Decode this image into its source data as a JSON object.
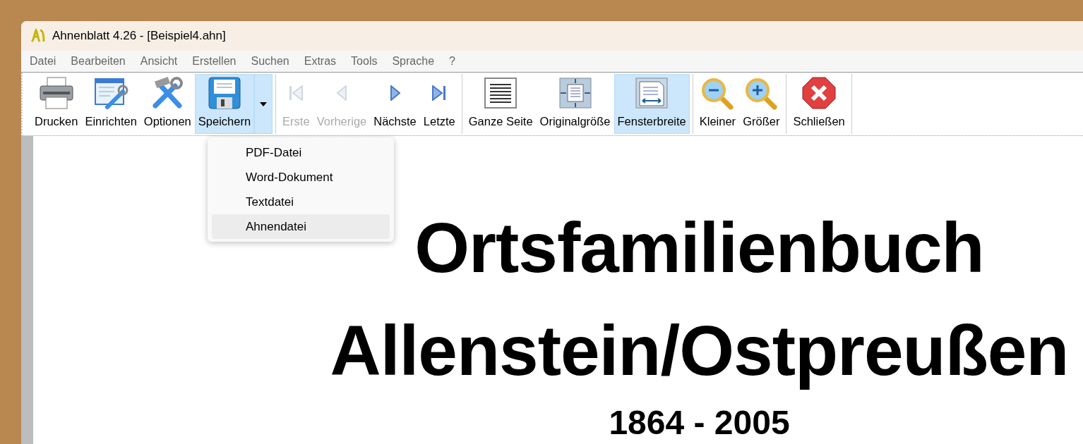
{
  "window": {
    "title": "Ahnenblatt 4.26 - [Beispiel4.ahn]"
  },
  "menu": [
    "Datei",
    "Bearbeiten",
    "Ansicht",
    "Erstellen",
    "Suchen",
    "Extras",
    "Tools",
    "Sprache",
    "?"
  ],
  "toolbar": {
    "groups": [
      [
        {
          "label": "Drucken",
          "kind": "print",
          "disabled": false,
          "selected": false
        },
        {
          "label": "Einrichten",
          "kind": "setup",
          "disabled": false,
          "selected": false
        },
        {
          "label": "Optionen",
          "kind": "tools",
          "disabled": false,
          "selected": false
        },
        {
          "label": "Speichern",
          "kind": "save",
          "disabled": false,
          "selected": true,
          "dropdown": true
        }
      ],
      [
        {
          "label": "Erste",
          "kind": "first",
          "disabled": true,
          "selected": false
        },
        {
          "label": "Vorherige",
          "kind": "prev",
          "disabled": true,
          "selected": false
        },
        {
          "label": "Nächste",
          "kind": "next",
          "disabled": false,
          "selected": false
        },
        {
          "label": "Letzte",
          "kind": "last",
          "disabled": false,
          "selected": false
        }
      ],
      [
        {
          "label": "Ganze Seite",
          "kind": "page",
          "disabled": false,
          "selected": false
        },
        {
          "label": "Originalgröße",
          "kind": "original",
          "disabled": false,
          "selected": false
        },
        {
          "label": "Fensterbreite",
          "kind": "width",
          "disabled": false,
          "selected": true
        }
      ],
      [
        {
          "label": "Kleiner",
          "kind": "zoomout",
          "disabled": false,
          "selected": false
        },
        {
          "label": "Größer",
          "kind": "zoomin",
          "disabled": false,
          "selected": false
        }
      ],
      [
        {
          "label": "Schließen",
          "kind": "close",
          "disabled": false,
          "selected": false
        }
      ]
    ]
  },
  "save_menu": [
    {
      "label": "PDF-Datei",
      "selected": false
    },
    {
      "label": "Word-Dokument",
      "selected": false
    },
    {
      "label": "Textdatei",
      "selected": false
    },
    {
      "label": "Ahnendatei",
      "selected": true
    }
  ],
  "document": {
    "title_lines": [
      "Ortsfamilienbuch",
      "Allenstein/Ostpreußen"
    ],
    "years": "1864 - 2005"
  }
}
